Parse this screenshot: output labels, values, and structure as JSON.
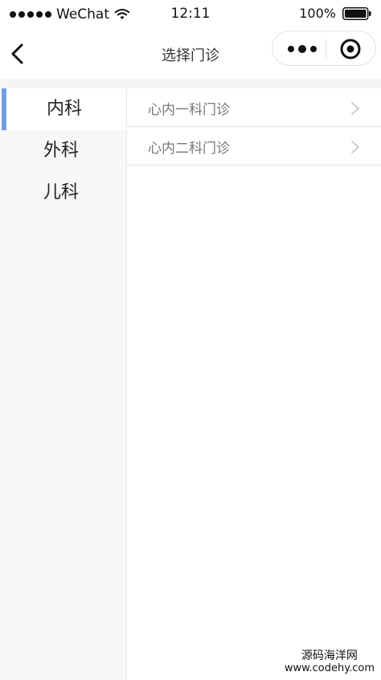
{
  "status_bar": {
    "carrier": "WeChat",
    "time": "12:11",
    "battery": "100%"
  },
  "nav": {
    "title": "选择门诊",
    "back_icon": "chevron-left-icon",
    "more_icon": "more-dots-icon",
    "close_icon": "target-circle-icon"
  },
  "sidebar": {
    "items": [
      {
        "label": "内科",
        "active": true
      },
      {
        "label": "外科",
        "active": false
      },
      {
        "label": "儿科",
        "active": false
      }
    ]
  },
  "clinics": [
    {
      "label": "心内一科门诊"
    },
    {
      "label": "心内二科门诊"
    }
  ],
  "watermark": {
    "line1": "源码海洋网",
    "line2": "www.codehy.com"
  },
  "colors": {
    "accent": "#6f9fe0",
    "sidebar_bg": "#f7f6f9"
  }
}
